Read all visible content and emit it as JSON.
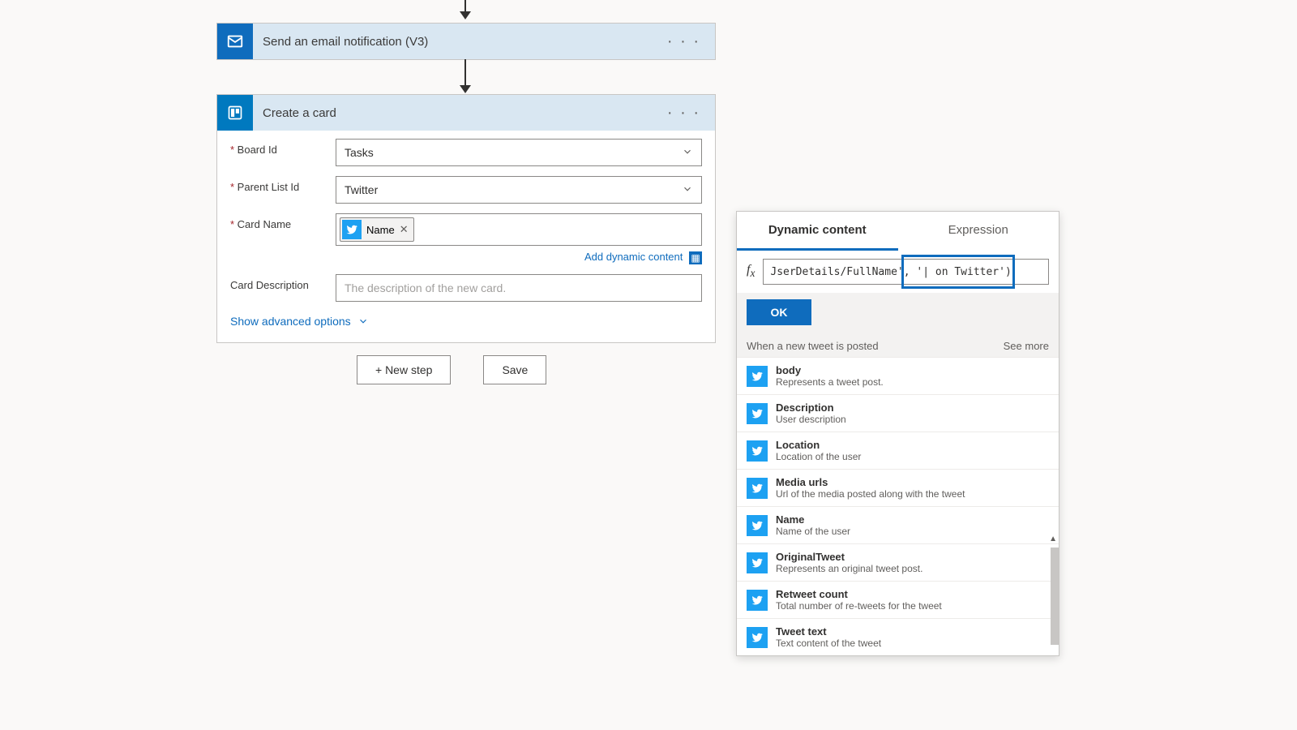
{
  "arrows": {},
  "email_action": {
    "title": "Send an email notification (V3)"
  },
  "card_action": {
    "title": "Create a card",
    "fields": {
      "board_id_label": "Board Id",
      "board_id_value": "Tasks",
      "parent_list_label": "Parent List Id",
      "parent_list_value": "Twitter",
      "card_name_label": "Card Name",
      "card_name_token": "Name",
      "add_dc": "Add dynamic content",
      "card_desc_label": "Card Description",
      "card_desc_placeholder": "The description of the new card.",
      "advanced": "Show advanced options"
    }
  },
  "footer": {
    "new_step": "+ New step",
    "save": "Save"
  },
  "popout": {
    "tabs": {
      "dynamic": "Dynamic content",
      "expression": "Expression"
    },
    "expression_text": "JserDetails/FullName', '| on Twitter')",
    "ok": "OK",
    "group_title": "When a new tweet is posted",
    "see_more": "See more",
    "items": [
      {
        "title": "body",
        "desc": "Represents a tweet post."
      },
      {
        "title": "Description",
        "desc": "User description"
      },
      {
        "title": "Location",
        "desc": "Location of the user"
      },
      {
        "title": "Media urls",
        "desc": "Url of the media posted along with the tweet"
      },
      {
        "title": "Name",
        "desc": "Name of the user"
      },
      {
        "title": "OriginalTweet",
        "desc": "Represents an original tweet post."
      },
      {
        "title": "Retweet count",
        "desc": "Total number of re-tweets for the tweet"
      },
      {
        "title": "Tweet text",
        "desc": "Text content of the tweet"
      }
    ]
  }
}
